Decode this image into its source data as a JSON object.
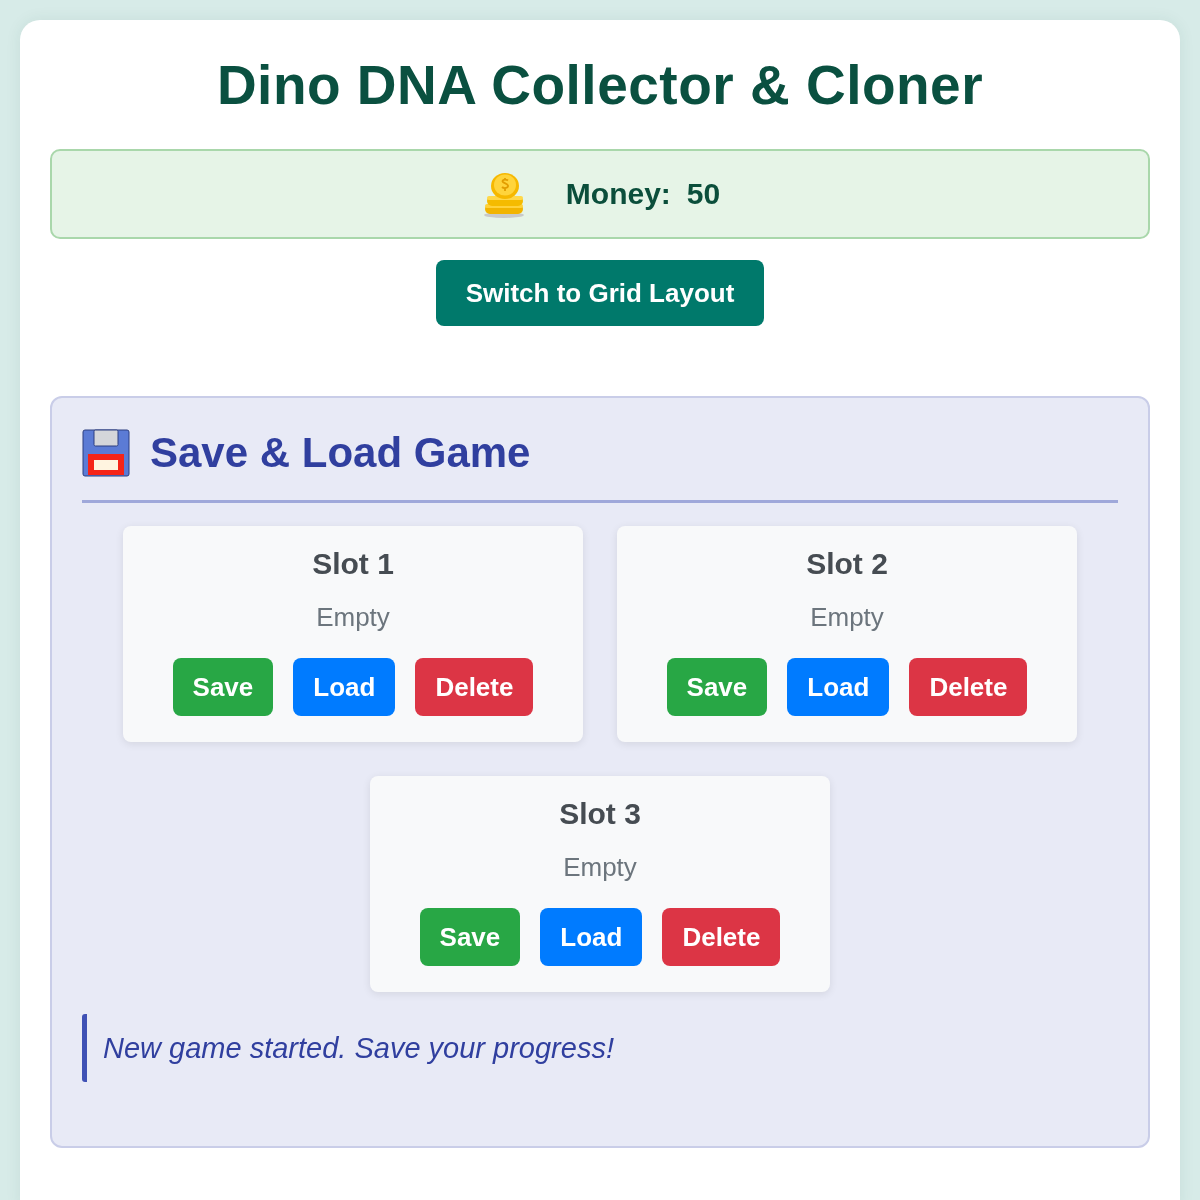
{
  "title": "Dino DNA Collector & Cloner",
  "money": {
    "label": "Money:",
    "value": "50"
  },
  "layout_button": "Switch to Grid Layout",
  "save_panel": {
    "title": "Save & Load Game",
    "slots": [
      {
        "name": "Slot 1",
        "status": "Empty",
        "buttons": [
          {
            "label": "Save",
            "kind": "save"
          },
          {
            "label": "Load",
            "kind": "load"
          },
          {
            "label": "Delete",
            "kind": "delete"
          }
        ]
      },
      {
        "name": "Slot 2",
        "status": "Empty",
        "buttons": [
          {
            "label": "Save",
            "kind": "save"
          },
          {
            "label": "Load",
            "kind": "load"
          },
          {
            "label": "Delete",
            "kind": "delete"
          }
        ]
      },
      {
        "name": "Slot 3",
        "status": "Empty",
        "buttons": [
          {
            "label": "Save",
            "kind": "save"
          },
          {
            "label": "Load",
            "kind": "load"
          },
          {
            "label": "Delete",
            "kind": "delete"
          }
        ]
      }
    ],
    "message": "New game started. Save your progress!"
  }
}
